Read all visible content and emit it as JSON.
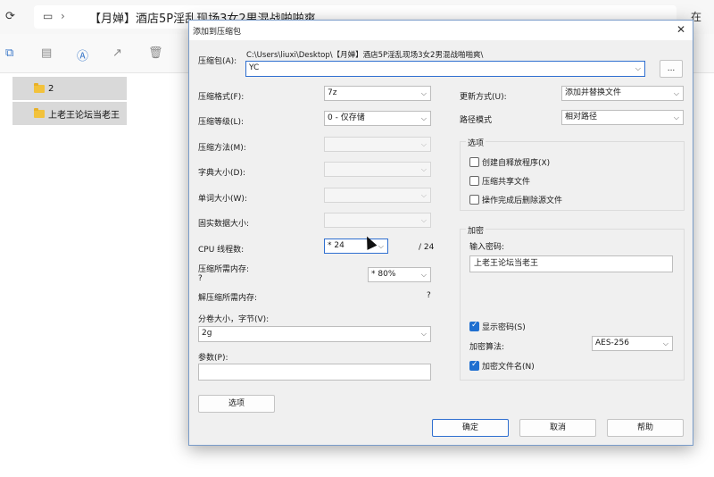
{
  "explorer": {
    "path": "【月婵】酒店5P淫乱现场3女2男混战啪啪爽",
    "right_text": "在",
    "files": [
      {
        "name": "2"
      },
      {
        "name": "上老王论坛当老王"
      }
    ]
  },
  "dialog": {
    "title": "添加到压缩包",
    "archive_label": "压缩包(A):",
    "archive_path": "C:\\Users\\liuxi\\Desktop\\【月婵】酒店5P淫乱现场3女2男混战啪啪爽\\",
    "archive_value": "YC",
    "browse_label": "...",
    "format_label": "压缩格式(F):",
    "format_value": "7z",
    "level_label": "压缩等级(L):",
    "level_value": "0 - 仅存储",
    "method_label": "压缩方法(M):",
    "dict_label": "字典大小(D):",
    "word_label": "单词大小(W):",
    "solid_label": "固实数据大小:",
    "cpu_label": "CPU 线程数:",
    "cpu_value": "* 24",
    "cpu_total": "/ 24",
    "mem_comp_label": "压缩所需内存:",
    "mem_comp_q": "?",
    "mem_comp_value": "* 80%",
    "mem_decomp_label": "解压缩所需内存:",
    "mem_decomp_value": "?",
    "volume_label": "分卷大小，字节(V):",
    "volume_value": "2g",
    "params_label": "参数(P):",
    "options_button": "选项",
    "update_label": "更新方式(U):",
    "update_value": "添加并替换文件",
    "pathmode_label": "路径模式",
    "pathmode_value": "相对路径",
    "options_group": "选项",
    "opt_sfx": "创建自释放程序(X)",
    "opt_shared": "压缩共享文件",
    "opt_delete": "操作完成后删除源文件",
    "encrypt_group": "加密",
    "password_label": "输入密码:",
    "password_value": "上老王论坛当老王",
    "show_password": "显示密码(S)",
    "enc_method_label": "加密算法:",
    "enc_method_value": "AES-256",
    "enc_names": "加密文件名(N)",
    "ok_button": "确定",
    "cancel_button": "取消",
    "help_button": "帮助"
  }
}
